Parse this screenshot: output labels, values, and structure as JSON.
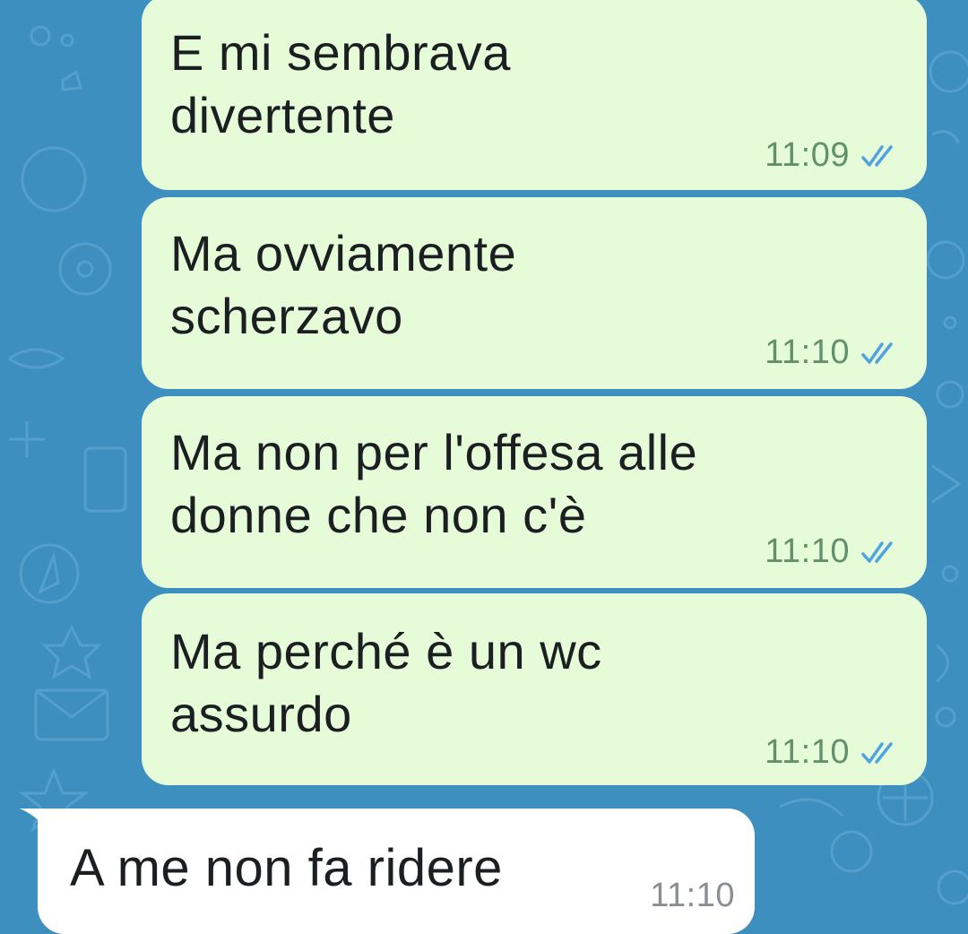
{
  "colors": {
    "background": "#3d8fbf",
    "outgoing_bubble": "#e6fcd8",
    "incoming_bubble": "#ffffff",
    "read_ticks": "#4fa3e0"
  },
  "messages": [
    {
      "direction": "outgoing",
      "text": "E mi sembrava\ndivertente",
      "time": "11:09",
      "status_icon": "double-check-icon"
    },
    {
      "direction": "outgoing",
      "text": "Ma ovviamente\nscherzavo",
      "time": "11:10",
      "status_icon": "double-check-icon"
    },
    {
      "direction": "outgoing",
      "text": "Ma non per l'offesa alle\ndonne che non c'è",
      "time": "11:10",
      "status_icon": "double-check-icon"
    },
    {
      "direction": "outgoing",
      "text": "Ma perché è un wc\nassurdo",
      "time": "11:10",
      "status_icon": "double-check-icon"
    },
    {
      "direction": "incoming",
      "text": "A me non fa ridere",
      "time": "11:10"
    }
  ]
}
